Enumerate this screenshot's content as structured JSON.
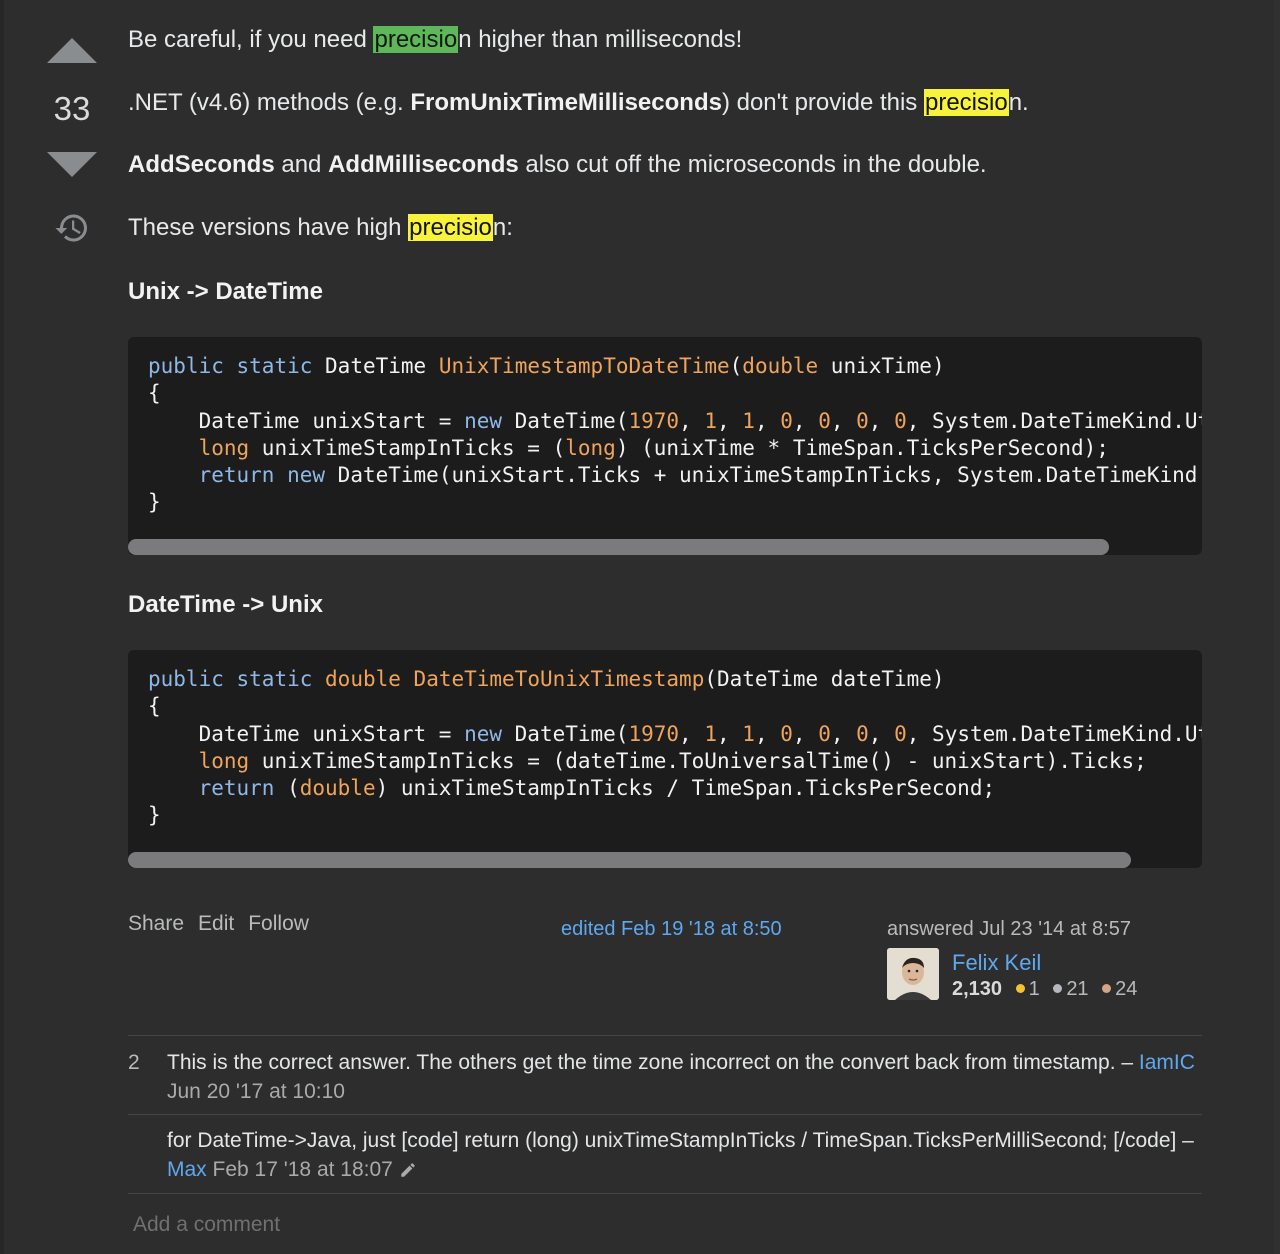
{
  "vote": {
    "count": "33"
  },
  "post": {
    "p1": {
      "pre": "Be careful, if you need ",
      "hl": "precisio",
      "post": "n higher than milliseconds!"
    },
    "p2": {
      "pre": ".NET (v4.6) methods (e.g. ",
      "bold": "FromUnixTimeMilliseconds",
      "mid": ") don't provide this ",
      "hl": "precisio",
      "post": "n."
    },
    "p3": {
      "bold1": "AddSeconds",
      "mid": " and ",
      "bold2": "AddMilliseconds",
      "post": " also cut off the microseconds in the double."
    },
    "p4": {
      "pre": "These versions have high ",
      "hl": "precisio",
      "post": "n:"
    },
    "heading1": "Unix -> DateTime",
    "heading2": "DateTime -> Unix",
    "code1": {
      "l1": {
        "kw1": "public",
        "kw2": "static",
        "type": "DateTime",
        "fn": "UnixTimestampToDateTime",
        "ptype": "double",
        "rest": " unixTime)"
      },
      "l2": "{",
      "l3": {
        "a": "    DateTime unixStart = ",
        "kw": "new",
        "b": " DateTime(",
        "nums": [
          "1970",
          "1",
          "1",
          "0",
          "0",
          "0",
          "0"
        ],
        "c": " System.DateTimeKind.Utc);"
      },
      "l4": {
        "kw": "long",
        "a": " unixTimeStampInTicks = (",
        "kw2": "long",
        "b": ") (unixTime * TimeSpan.TicksPerSecond);"
      },
      "l5": {
        "kw": "return",
        "kw2": "new",
        "a": " DateTime(unixStart.Ticks + unixTimeStampInTicks, System.DateTimeKind.Utc);"
      },
      "l6": "}"
    },
    "code2": {
      "l1": {
        "kw1": "public",
        "kw2": "static",
        "ptype": "double",
        "fn": "DateTimeToUnixTimestamp",
        "rest": "(DateTime dateTime)"
      },
      "l2": "{",
      "l3": {
        "a": "    DateTime unixStart = ",
        "kw": "new",
        "b": " DateTime(",
        "nums": [
          "1970",
          "1",
          "1",
          "0",
          "0",
          "0",
          "0"
        ],
        "c": " System.DateTimeKind.Utc);"
      },
      "l4": {
        "kw": "long",
        "a": " unixTimeStampInTicks = (dateTime.ToUniversalTime() - unixStart).Ticks;"
      },
      "l5": {
        "kw": "return",
        "kw2": "double",
        "a": ") unixTimeStampInTicks / TimeSpan.TicksPerSecond;"
      },
      "l6": "}"
    }
  },
  "menu": {
    "share": "Share",
    "edit": "Edit",
    "follow": "Follow"
  },
  "edited": "edited Feb 19 '18 at 8:50",
  "user": {
    "answered": "answered Jul 23 '14 at 8:57",
    "name": "Felix Keil",
    "rep": "2,130",
    "gold": "1",
    "silver": "21",
    "bronze": "24",
    "gold_color": "#f1c232",
    "silver_color": "#b4b8bc",
    "bronze_color": "#d1a684"
  },
  "comments": [
    {
      "score": "2",
      "text": "This is the correct answer. The others get the time zone incorrect on the convert back from timestamp. – ",
      "user": "IamIC",
      "date": "Jun 20 '17 at 10:10"
    },
    {
      "score": "",
      "text": "for DateTime->Java, just [code] return (long) unixTimeStampInTicks / TimeSpan.TicksPerMilliSecond; [/code] – ",
      "user": "Max",
      "date": "Feb 17 '18 at 18:07"
    }
  ],
  "add_comment": "Add a comment"
}
